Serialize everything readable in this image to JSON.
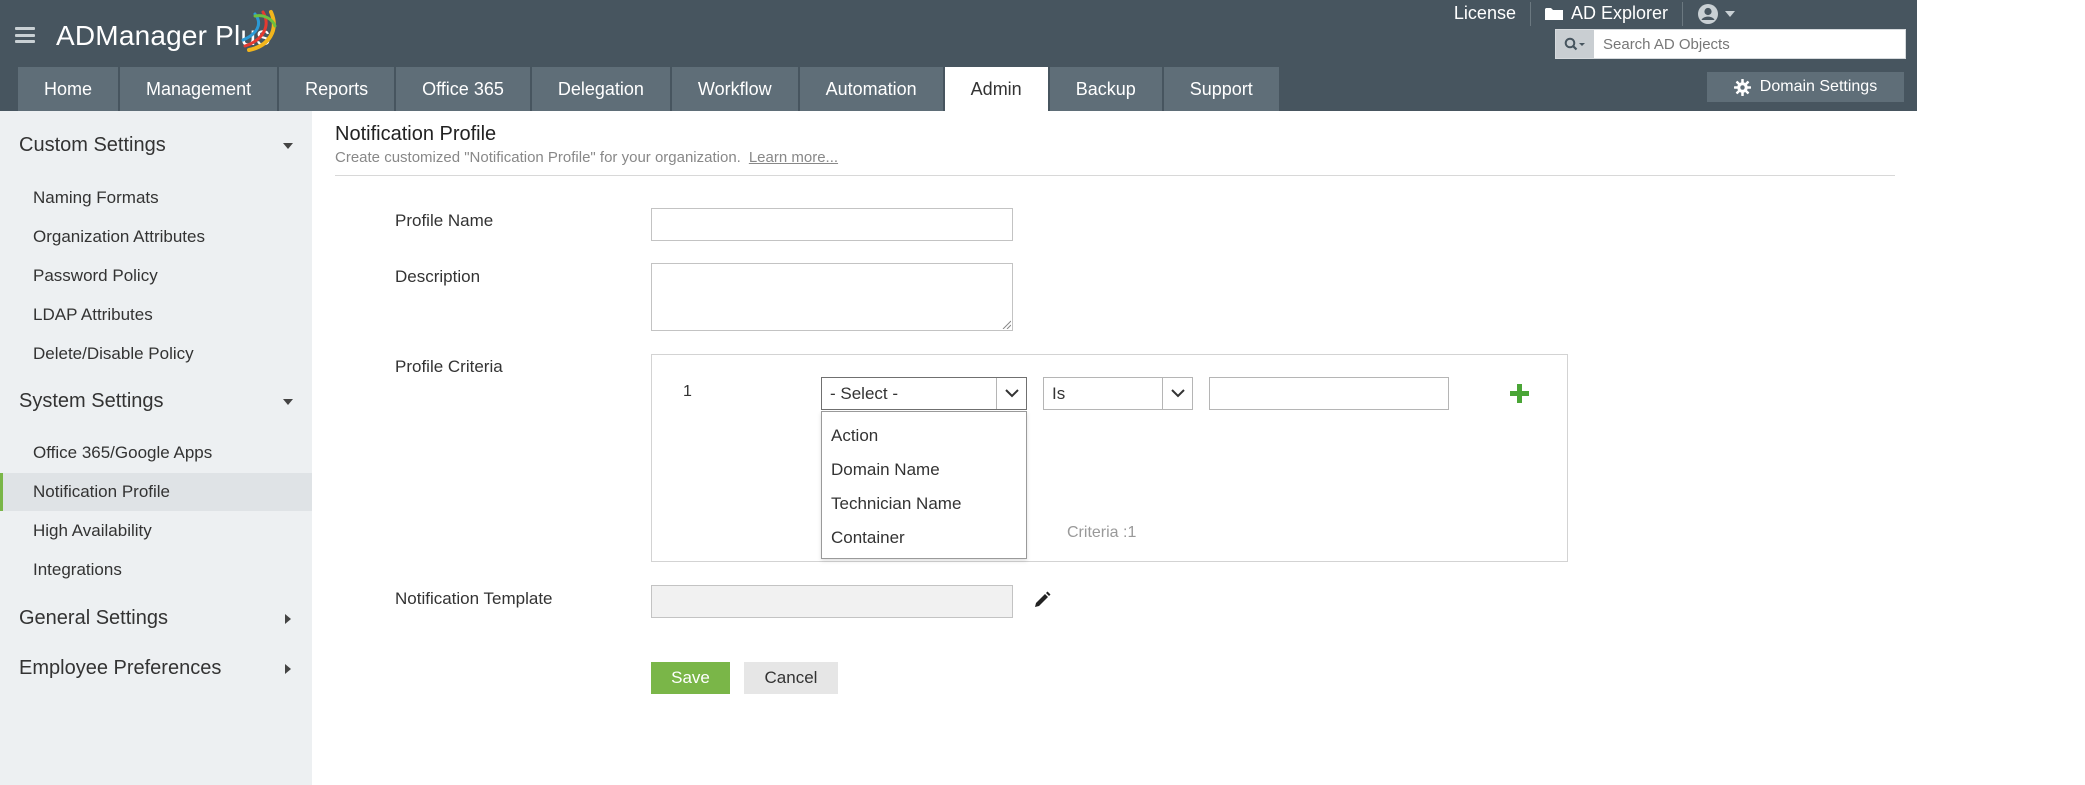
{
  "app": {
    "brand": "ADManager Plus"
  },
  "top_links": {
    "license": "License",
    "ad_explorer": "AD Explorer"
  },
  "search": {
    "placeholder": "Search AD Objects",
    "value": ""
  },
  "tabs": [
    {
      "label": "Home",
      "active": false
    },
    {
      "label": "Management",
      "active": false
    },
    {
      "label": "Reports",
      "active": false
    },
    {
      "label": "Office 365",
      "active": false
    },
    {
      "label": "Delegation",
      "active": false
    },
    {
      "label": "Workflow",
      "active": false
    },
    {
      "label": "Automation",
      "active": false
    },
    {
      "label": "Admin",
      "active": true
    },
    {
      "label": "Backup",
      "active": false
    },
    {
      "label": "Support",
      "active": false
    }
  ],
  "domain_settings": {
    "label": "Domain Settings"
  },
  "sidebar": {
    "custom_settings": {
      "title": "Custom Settings",
      "expanded": true,
      "items": [
        "Naming Formats",
        "Organization Attributes",
        "Password Policy",
        "LDAP Attributes",
        "Delete/Disable Policy"
      ]
    },
    "system_settings": {
      "title": "System Settings",
      "expanded": true,
      "items": [
        "Office 365/Google Apps",
        "Notification Profile",
        "High Availability",
        "Integrations"
      ],
      "active_item": "Notification Profile"
    },
    "general_settings": {
      "title": "General Settings",
      "expanded": false
    },
    "employee_preferences": {
      "title": "Employee Preferences",
      "expanded": false
    }
  },
  "page": {
    "title": "Notification Profile",
    "subtitle": "Create customized \"Notification Profile\" for your organization.",
    "learn_more": "Learn more..."
  },
  "form": {
    "profile_name_label": "Profile Name",
    "profile_name_value": "",
    "description_label": "Description",
    "description_value": "",
    "profile_criteria_label": "Profile Criteria",
    "criteria": {
      "row_number": "1",
      "attribute_select": "- Select -",
      "operator_select": "Is",
      "value": "",
      "dropdown_options": [
        "Action",
        "Domain Name",
        "Technician Name",
        "Container"
      ],
      "count_text": "Criteria :1"
    },
    "notification_template_label": "Notification Template",
    "notification_template_value": "",
    "save_label": "Save",
    "cancel_label": "Cancel"
  },
  "colors": {
    "header_bg": "#47555f",
    "tab_bg": "#5f6e78",
    "accent_green": "#7ab648",
    "sidebar_bg": "#edf0f2"
  }
}
